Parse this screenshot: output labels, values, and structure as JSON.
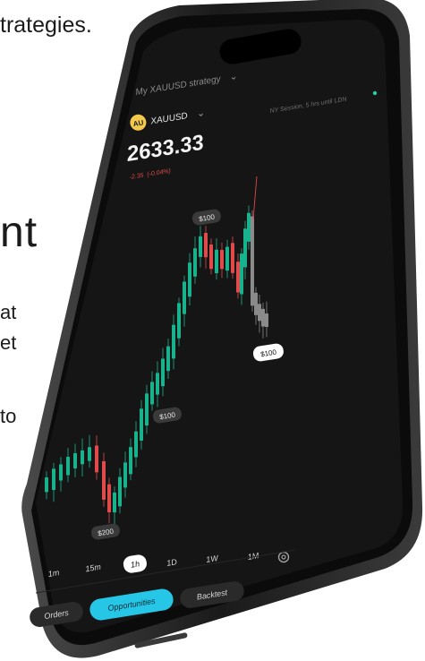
{
  "background": {
    "line1": "trategies.",
    "line2": "nt",
    "line3": "at",
    "line4": "et",
    "line5": "to"
  },
  "header": {
    "strategy_label": "My XAUUSD strategy",
    "session_text": "NY Session, 5 hrs until LDN",
    "status_color": "#22d3a6"
  },
  "instrument": {
    "badge": "AU",
    "symbol": "XAUUSD",
    "price": "2633.33",
    "change": "-2.35  (-0.04%)"
  },
  "chart_data": {
    "type": "candlestick",
    "annotations": [
      {
        "label": "$100"
      },
      {
        "label": "$100"
      },
      {
        "label": "$100"
      },
      {
        "label": "$200"
      }
    ],
    "colors": {
      "up": "#18b38c",
      "down": "#e04a4a",
      "pending": "#8a8a8a"
    }
  },
  "timeframes": [
    "1m",
    "15m",
    "1h",
    "1D",
    "1W",
    "1M"
  ],
  "active_timeframe": "1h",
  "nav": {
    "orders": "Orders",
    "opportunities": "Opportunities",
    "backtest": "Backtest"
  }
}
